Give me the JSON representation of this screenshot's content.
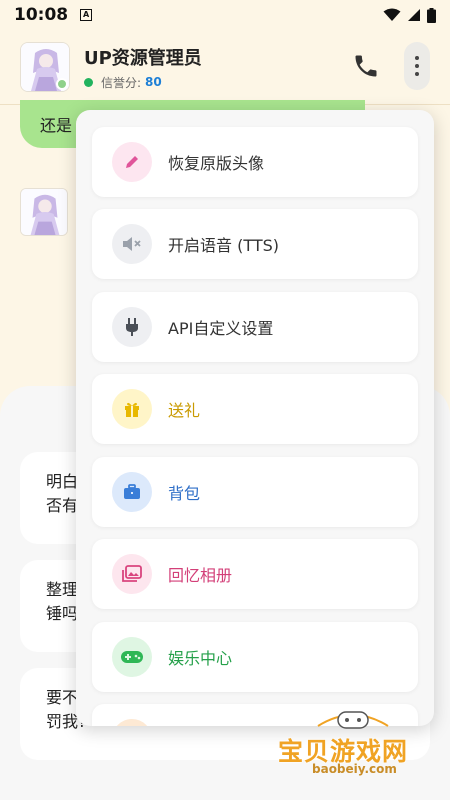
{
  "status_bar": {
    "time": "10:08",
    "notification_icon": "text-a-icon",
    "icons": [
      "wifi-icon",
      "signal-icon",
      "battery-icon"
    ]
  },
  "header": {
    "title": "UP资源管理员",
    "credit_label": "信誉分:",
    "credit_score": "80",
    "online": true
  },
  "chat": {
    "green_bubble_text": "还是",
    "options": [
      {
        "line1": "明白",
        "line2": "否有"
      },
      {
        "line1": "整理",
        "line2": "锤吗"
      },
      {
        "line1": "要不",
        "line2": "罚我?"
      }
    ]
  },
  "menu": {
    "items": [
      {
        "label": "恢复原版头像",
        "icon": "pencil-icon",
        "icon_bg": "#fde6f0",
        "icon_color": "#e0559a",
        "text_color": "#333333"
      },
      {
        "label": "开启语音 (TTS)",
        "icon": "speaker-muted-icon",
        "icon_bg": "#eeeff2",
        "icon_color": "#9aa1ab",
        "text_color": "#333333"
      },
      {
        "label": "API自定义设置",
        "icon": "plug-icon",
        "icon_bg": "#eeeff2",
        "icon_color": "#4a4f57",
        "text_color": "#333333"
      },
      {
        "label": "送礼",
        "icon": "gift-icon",
        "icon_bg": "#fff5c8",
        "icon_color": "#e8b800",
        "text_color": "#c99a00"
      },
      {
        "label": "背包",
        "icon": "briefcase-icon",
        "icon_bg": "#dce9fb",
        "icon_color": "#3a7ed8",
        "text_color": "#2f6fc8"
      },
      {
        "label": "回忆相册",
        "icon": "photo-album-icon",
        "icon_bg": "#fde6ee",
        "icon_color": "#d9457e",
        "text_color": "#d33f78"
      },
      {
        "label": "娱乐中心",
        "icon": "gamepad-icon",
        "icon_bg": "#dff6e3",
        "icon_color": "#2fb756",
        "text_color": "#25a04a"
      }
    ]
  },
  "watermark": {
    "title": "宝贝游戏网",
    "url": "baobeiy.com"
  }
}
